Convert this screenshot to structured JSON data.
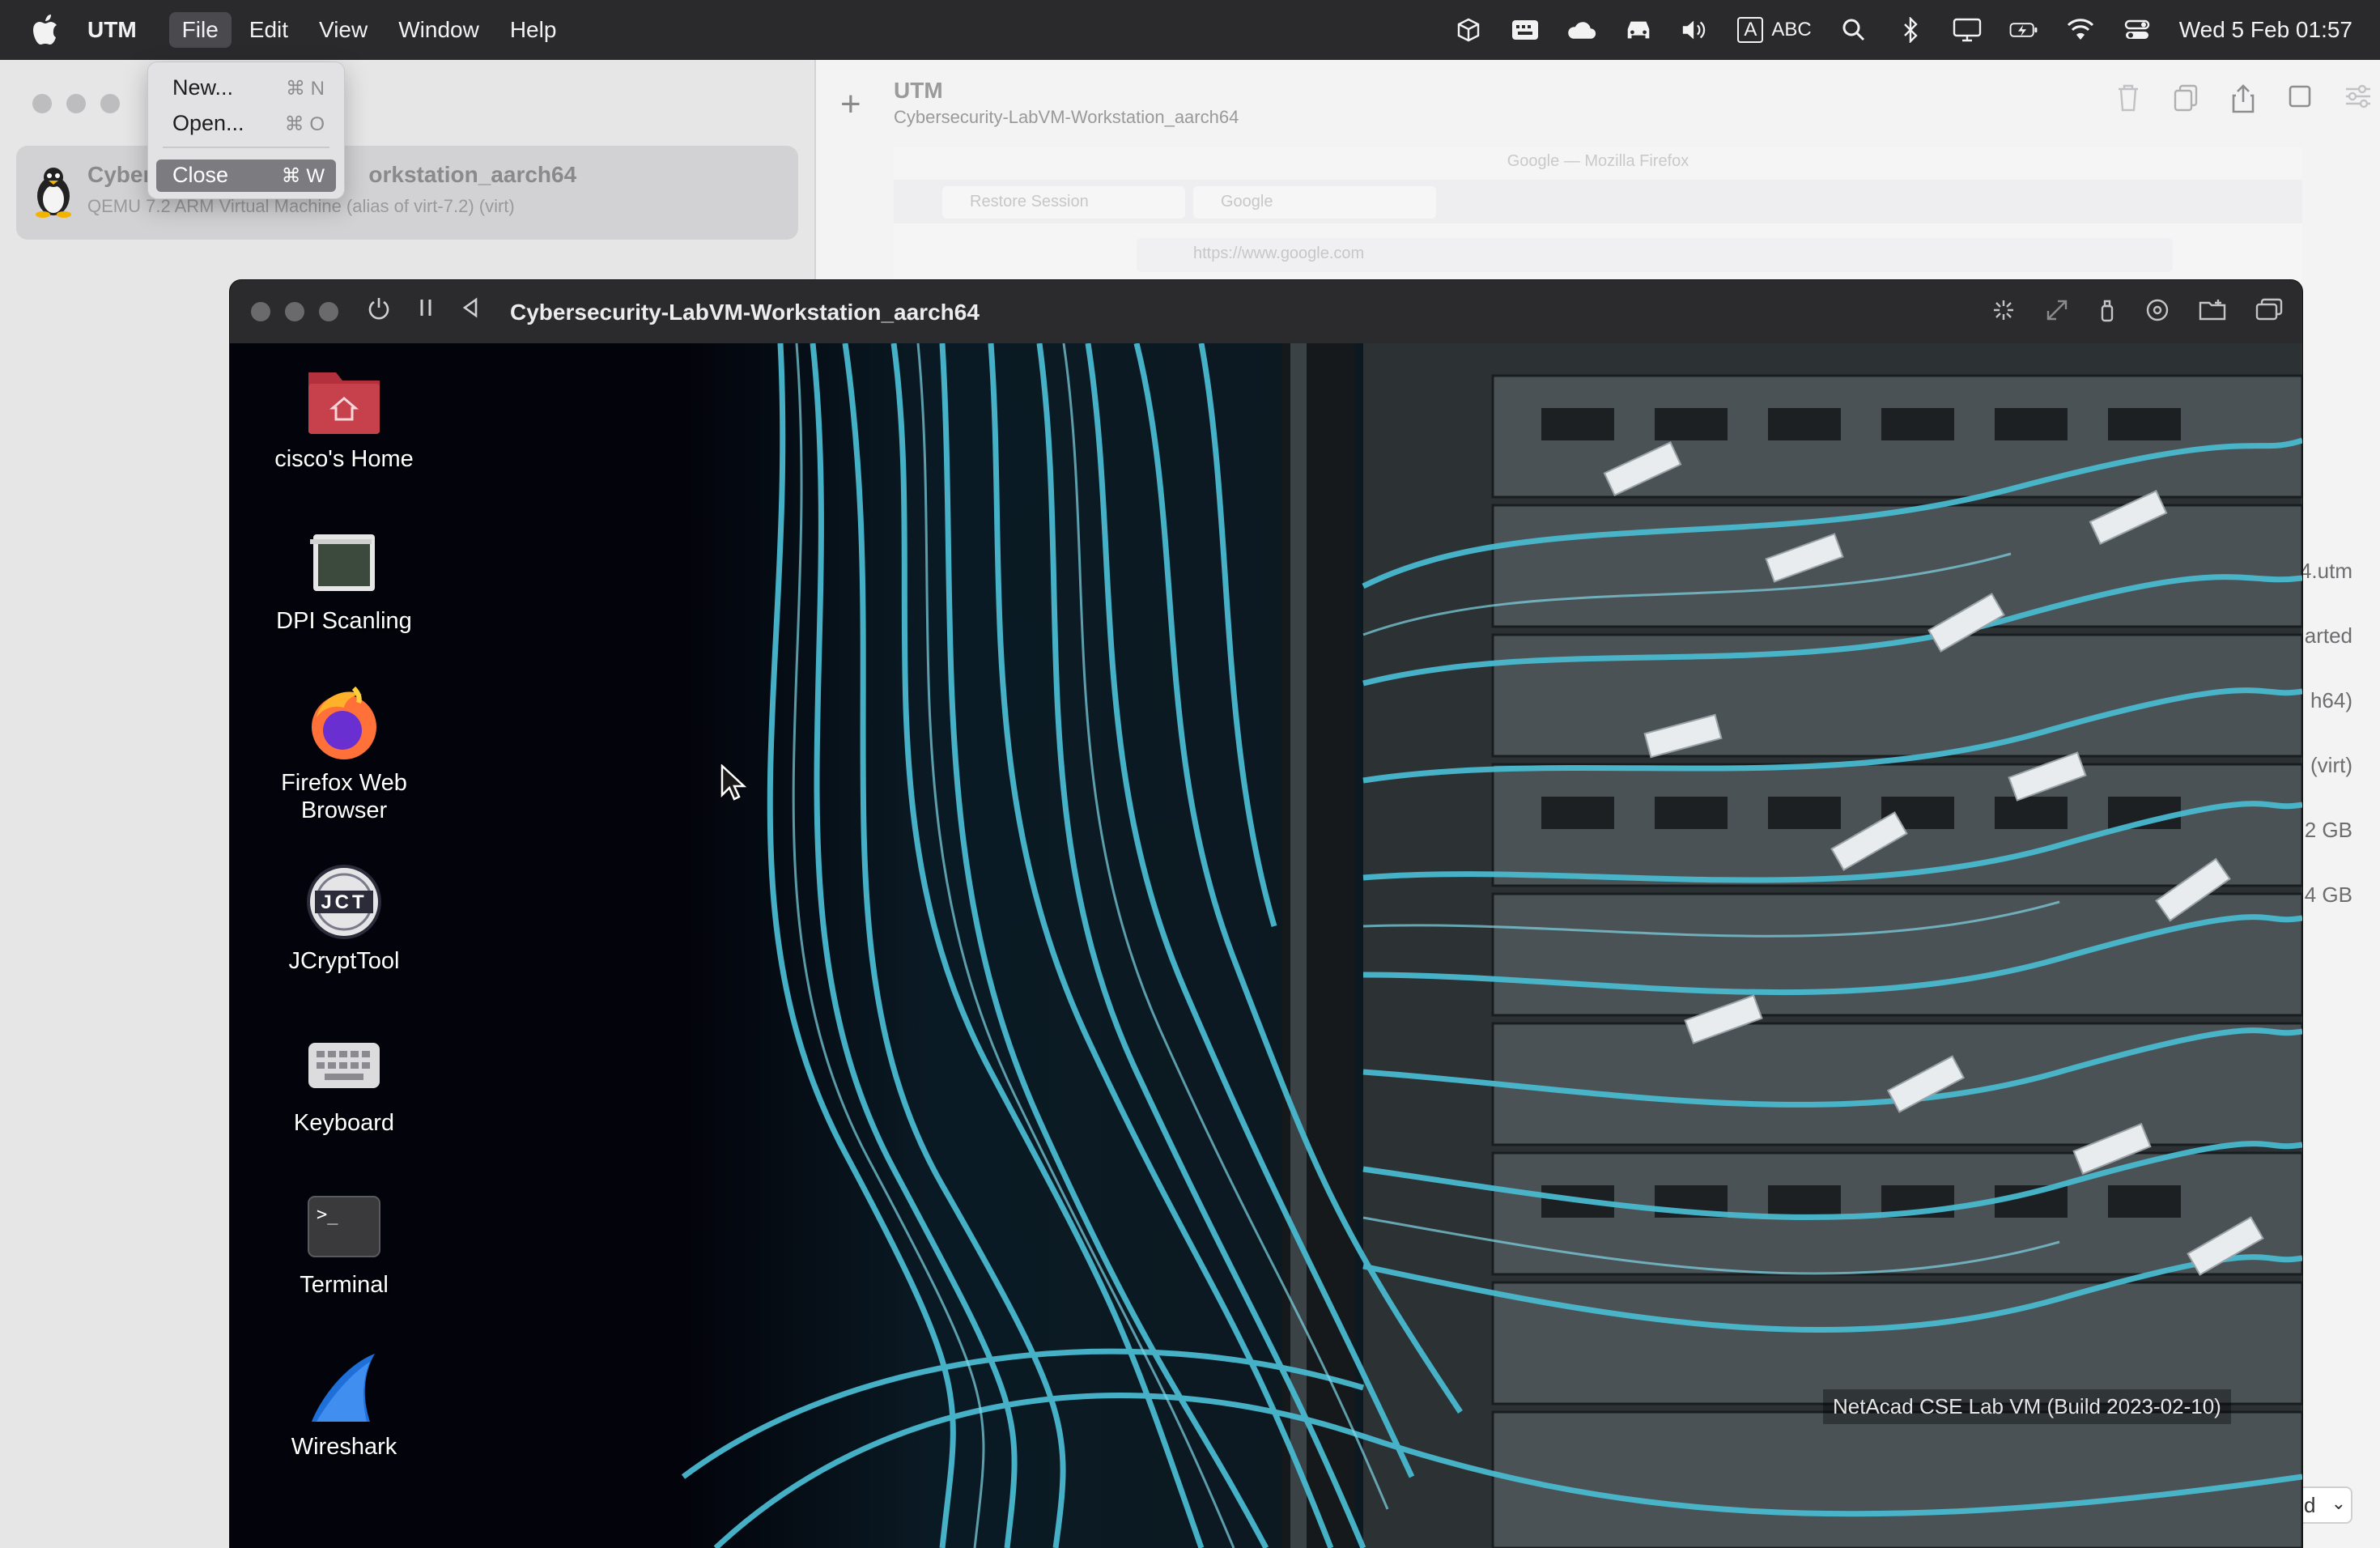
{
  "menubar": {
    "app_name": "UTM",
    "menus": [
      "File",
      "Edit",
      "View",
      "Window",
      "Help"
    ],
    "status_icons": [
      "cube-icon",
      "keyboard-icon",
      "cloud-icon",
      "car-icon",
      "volume-icon",
      "input-source-icon",
      "spotlight-icon",
      "bluetooth-icon",
      "display-icon",
      "battery-icon",
      "wifi-icon",
      "control-center-icon"
    ],
    "input_source_letter": "A",
    "input_source_label": "ABC",
    "clock": "Wed 5 Feb  01:57"
  },
  "file_menu": {
    "items": [
      {
        "label": "New...",
        "shortcut": "⌘ N"
      },
      {
        "label": "Open...",
        "shortcut": "⌘ O"
      },
      {
        "label": "Close",
        "shortcut": "⌘ W"
      }
    ]
  },
  "sidebar": {
    "vm_name_prefix": "Cyber",
    "vm_name_suffix": "orkstation_aarch64",
    "vm_subtitle": "QEMU 7.2 ARM Virtual Machine (alias of virt-7.2) (virt)"
  },
  "toolbar": {
    "title": "UTM",
    "subtitle": "Cybersecurity-LabVM-Workstation_aarch64",
    "add_label": "+"
  },
  "preview": {
    "window_title": "Google — Mozilla Firefox",
    "tab1": "Restore Session",
    "tab2": "Google",
    "url": "https://www.google.com"
  },
  "info_peek": {
    "rows": [
      "4.utm",
      "arted",
      "h64)",
      "(virt)",
      "2 GB",
      "4 GB"
    ],
    "select_value": "d"
  },
  "vm_window": {
    "title": "Cybersecurity-LabVM-Workstation_aarch64"
  },
  "desktop": {
    "icons": [
      {
        "label": "cisco's Home"
      },
      {
        "label": "DPI Scanling"
      },
      {
        "label": "Firefox Web Browser"
      },
      {
        "label": "JCryptTool"
      },
      {
        "label": "Keyboard"
      },
      {
        "label": "Terminal"
      },
      {
        "label": "Wireshark"
      }
    ],
    "wallpaper_caption": "NetAcad CSE Lab VM (Build 2023-02-10)",
    "jct_badge": "JCT",
    "terminal_prompt": ">_"
  }
}
